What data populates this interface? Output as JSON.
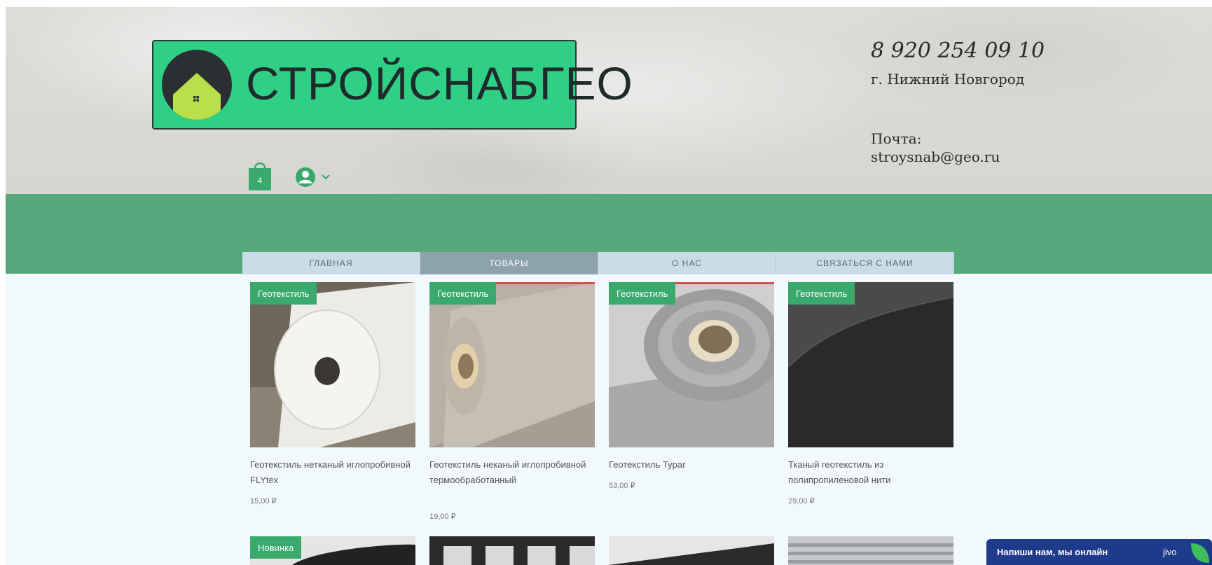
{
  "header": {
    "logo_text": "СТРОЙСНАБГЕО",
    "phone": "8 920 254 09 10",
    "city": "г. Нижний Новгород",
    "mail_label": "Почта:",
    "email": "stroysnab@geo.ru",
    "cart_count": "4"
  },
  "nav": {
    "items": [
      {
        "label": "ГЛАВНАЯ"
      },
      {
        "label": "ТОВАРЫ"
      },
      {
        "label": "О НАС"
      },
      {
        "label": "СВЯЗАТЬСЯ С НАМИ"
      }
    ]
  },
  "products": [
    {
      "badge": "Геотекстиль",
      "name": "Геотекстиль нетканый иглопробивной FLYtex",
      "price": "15,00 ₽"
    },
    {
      "badge": "Геотекстиль",
      "name": "Геотекстиль неканый иглопробивной термообработанный",
      "price": "19,00 ₽"
    },
    {
      "badge": "Геотекстиль",
      "name": "Геотекстиль Typar",
      "price": "53,00 ₽"
    },
    {
      "badge": "Геотекстиль",
      "name": "Тканый геотекстиль из полипропиленовой нити",
      "price": "29,00 ₽"
    }
  ],
  "next_row": [
    {
      "badge": "Новинка"
    }
  ],
  "chat": {
    "label": "Напиши нам, мы онлайн",
    "brand": "jivo"
  },
  "colors": {
    "band": "#57a87a",
    "badge": "#3aa96d",
    "logo_bg": "#2fcf85",
    "chat": "#1e3a8a"
  }
}
